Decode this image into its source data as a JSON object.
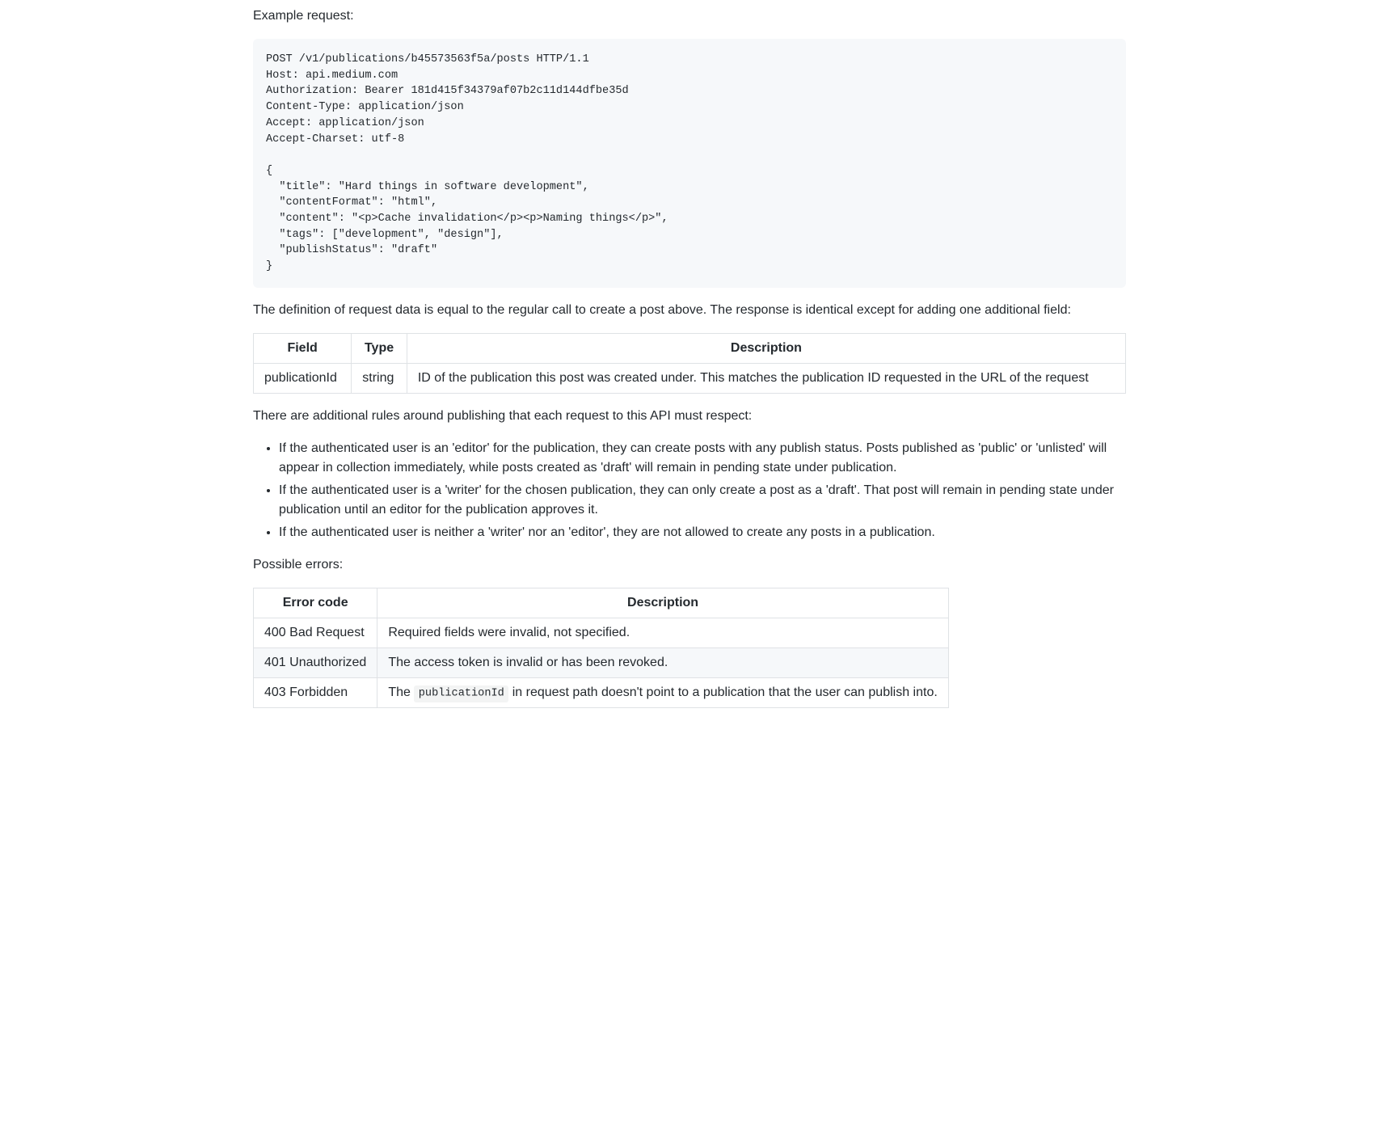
{
  "example_label": "Example request:",
  "code_block": "POST /v1/publications/b45573563f5a/posts HTTP/1.1\nHost: api.medium.com\nAuthorization: Bearer 181d415f34379af07b2c11d144dfbe35d\nContent-Type: application/json\nAccept: application/json\nAccept-Charset: utf-8\n\n{\n  \"title\": \"Hard things in software development\",\n  \"contentFormat\": \"html\",\n  \"content\": \"<p>Cache invalidation</p><p>Naming things</p>\",\n  \"tags\": [\"development\", \"design\"],\n  \"publishStatus\": \"draft\"\n}",
  "definition_text": "The definition of request data is equal to the regular call to create a post above. The response is identical except for adding one additional field:",
  "fields_table": {
    "headers": {
      "field": "Field",
      "type": "Type",
      "description": "Description"
    },
    "row": {
      "field": "publicationId",
      "type": "string",
      "description": "ID of the publication this post was created under. This matches the publication ID requested in the URL of the request"
    }
  },
  "rules_intro": "There are additional rules around publishing that each request to this API must respect:",
  "rules": [
    "If the authenticated user is an 'editor' for the publication, they can create posts with any publish status. Posts published as 'public' or 'unlisted' will appear in collection immediately, while posts created as 'draft' will remain in pending state under publication.",
    "If the authenticated user is a 'writer' for the chosen publication, they can only create a post as a 'draft'. That post will remain in pending state under publication until an editor for the publication approves it.",
    "If the authenticated user is neither a 'writer' nor an 'editor', they are not allowed to create any posts in a publication."
  ],
  "errors_label": "Possible errors:",
  "errors_table": {
    "headers": {
      "code": "Error code",
      "description": "Description"
    },
    "rows": [
      {
        "code": "400 Bad Request",
        "description": "Required fields were invalid, not specified."
      },
      {
        "code": "401 Unauthorized",
        "description": "The access token is invalid or has been revoked."
      },
      {
        "code": "403 Forbidden",
        "description_prefix": "The ",
        "description_code": "publicationId",
        "description_suffix": " in request path doesn't point to a publication that the user can publish into."
      }
    ]
  }
}
